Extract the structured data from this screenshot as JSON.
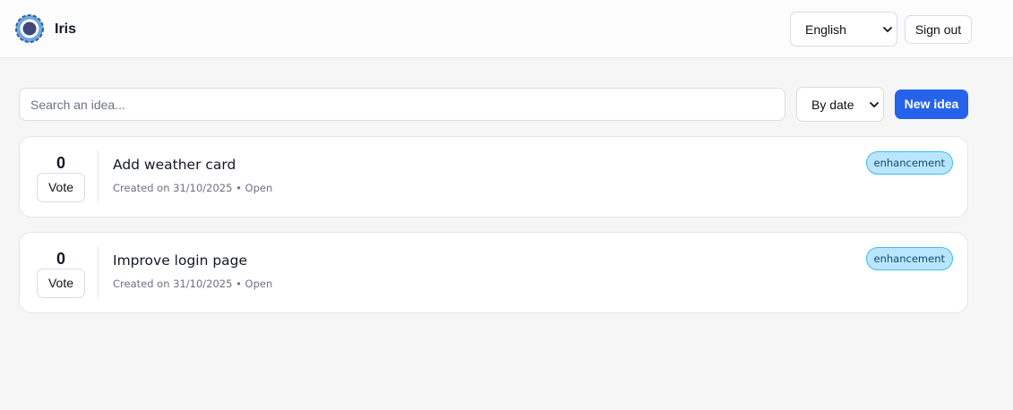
{
  "header": {
    "app_name": "Iris",
    "logo_icon": "iris-ring-logo-icon",
    "language": {
      "selected": "English"
    },
    "sign_out_label": "Sign out"
  },
  "toolbar": {
    "search_placeholder": "Search an idea...",
    "sort": {
      "selected": "By date"
    },
    "new_idea_label": "New idea"
  },
  "ideas": [
    {
      "votes": "0",
      "vote_label": "Vote",
      "title": "Add weather card",
      "meta": "Created on 31/10/2025 • Open",
      "tag": "enhancement"
    },
    {
      "votes": "0",
      "vote_label": "Vote",
      "title": "Improve login page",
      "meta": "Created on 31/10/2025 • Open",
      "tag": "enhancement"
    }
  ],
  "colors": {
    "accent": "#2563eb",
    "tag_bg": "#bae6fd",
    "tag_border": "#38bdf8",
    "logo_blue": "#3b82c4",
    "logo_center": "#3f4a7a"
  }
}
